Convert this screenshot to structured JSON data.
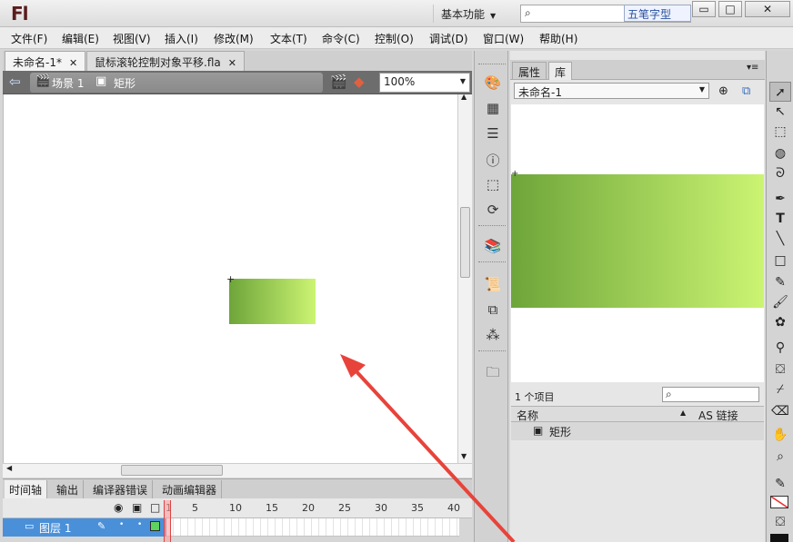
{
  "app": {
    "logo": "Fl",
    "workspace": "基本功能",
    "ime_badge": "五笔字型",
    "search_value": ""
  },
  "window_buttons": {
    "minimize": "▭",
    "maximize": "□",
    "close": "✕"
  },
  "menu": [
    "文件(F)",
    "编辑(E)",
    "视图(V)",
    "插入(I)",
    "修改(M)",
    "文本(T)",
    "命令(C)",
    "控制(O)",
    "调试(D)",
    "窗口(W)",
    "帮助(H)"
  ],
  "doc_tabs": [
    {
      "label": "未命名-1*",
      "close": "✕",
      "active": true
    },
    {
      "label": "鼠标滚轮控制对象平移.fla",
      "close": "✕",
      "active": false
    }
  ],
  "edit_bar": {
    "scene": "场景 1",
    "symbol": "矩形",
    "zoom": "100%"
  },
  "timeline": {
    "tabs": [
      "时间轴",
      "输出",
      "编译器错误",
      "动画编辑器"
    ],
    "frame_numbers": [
      "1",
      "5",
      "10",
      "15",
      "20",
      "25",
      "30",
      "35",
      "40"
    ],
    "layer_name": "图层 1"
  },
  "library": {
    "tabs": [
      "属性",
      "库"
    ],
    "doc_name": "未命名-1",
    "item_count": "1 个项目",
    "col_name": "名称",
    "col_linkage": "AS 链接",
    "items": [
      {
        "name": "矩形"
      }
    ]
  },
  "colors": {
    "gradient_start": "#6ea53a",
    "gradient_end": "#cbf472",
    "annotation_arrow": "#e8433a"
  },
  "icons": {
    "tools": [
      "selection-icon",
      "subselection-icon",
      "free-transform-icon",
      "3d-rotation-icon",
      "lasso-icon",
      "pen-icon",
      "text-icon",
      "line-icon",
      "rectangle-icon",
      "pencil-icon",
      "brush-icon",
      "deco-icon",
      "bone-icon",
      "paint-bucket-icon",
      "eyedropper-icon",
      "eraser-icon",
      "hand-icon",
      "zoom-icon",
      "stroke-color-icon",
      "fill-color-icon"
    ]
  }
}
